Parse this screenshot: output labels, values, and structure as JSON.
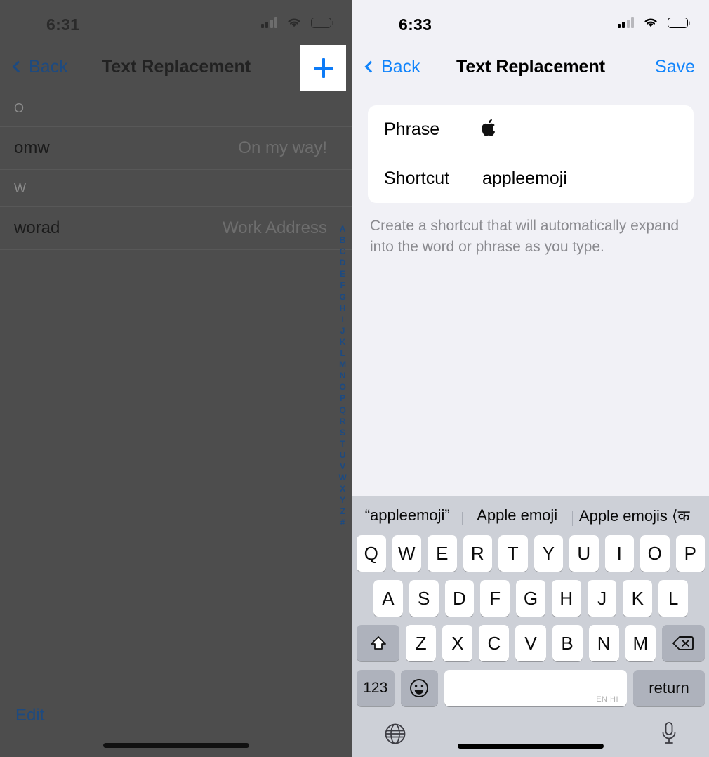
{
  "left_panel": {
    "status_bar": {
      "time": "6:31",
      "cellular_icon": "cellular-bars-icon",
      "wifi_icon": "wifi-icon",
      "battery_icon": "battery-icon",
      "signal_bars_filled": 2,
      "signal_bars_total": 4
    },
    "nav": {
      "back_label": "Back",
      "title": "Text Replacement",
      "add_icon": "plus-icon"
    },
    "sections": [
      {
        "header": "O",
        "rows": [
          {
            "shortcut": "omw",
            "phrase": "On my way!"
          }
        ]
      },
      {
        "header": "W",
        "rows": [
          {
            "shortcut": "worad",
            "phrase": "Work Address"
          }
        ]
      }
    ],
    "index_letters": [
      "A",
      "B",
      "C",
      "D",
      "E",
      "F",
      "G",
      "H",
      "I",
      "J",
      "K",
      "L",
      "M",
      "N",
      "O",
      "P",
      "Q",
      "R",
      "S",
      "T",
      "U",
      "V",
      "W",
      "X",
      "Y",
      "Z",
      "#"
    ],
    "edit_label": "Edit"
  },
  "right_panel": {
    "status_bar": {
      "time": "6:33",
      "cellular_icon": "cellular-bars-icon",
      "wifi_icon": "wifi-icon",
      "battery_icon": "battery-icon",
      "signal_bars_filled": 2,
      "signal_bars_total": 4
    },
    "nav": {
      "back_label": "Back",
      "title": "Text Replacement",
      "save_label": "Save"
    },
    "form": {
      "phrase_label": "Phrase",
      "phrase_value": "",
      "shortcut_label": "Shortcut",
      "shortcut_value": "appleemoji",
      "help_text": "Create a shortcut that will automatically expand into the word or phrase as you type."
    },
    "keyboard": {
      "suggestions": [
        "“appleemoji”",
        "Apple emoji",
        "Apple emojis ⟨क"
      ],
      "row1": [
        "Q",
        "W",
        "E",
        "R",
        "T",
        "Y",
        "U",
        "I",
        "O",
        "P"
      ],
      "row2": [
        "A",
        "S",
        "D",
        "F",
        "G",
        "H",
        "J",
        "K",
        "L"
      ],
      "row3": [
        "Z",
        "X",
        "C",
        "V",
        "B",
        "N",
        "M"
      ],
      "shift_icon": "shift-arrow-icon",
      "backspace_icon": "backspace-icon",
      "numbers_label": "123",
      "emoji_icon": "emoji-smiley-icon",
      "space_languages": "EN HI",
      "return_label": "return",
      "globe_icon": "globe-icon",
      "microphone_icon": "microphone-icon"
    }
  },
  "colors": {
    "ios_blue": "#1184fb",
    "dim_overlay": "#4d4d4d",
    "panel_bg": "#f1f1f6",
    "keyboard_bg": "#cdd0d7",
    "key_white": "#ffffff",
    "key_gray": "#aeb2bc"
  }
}
